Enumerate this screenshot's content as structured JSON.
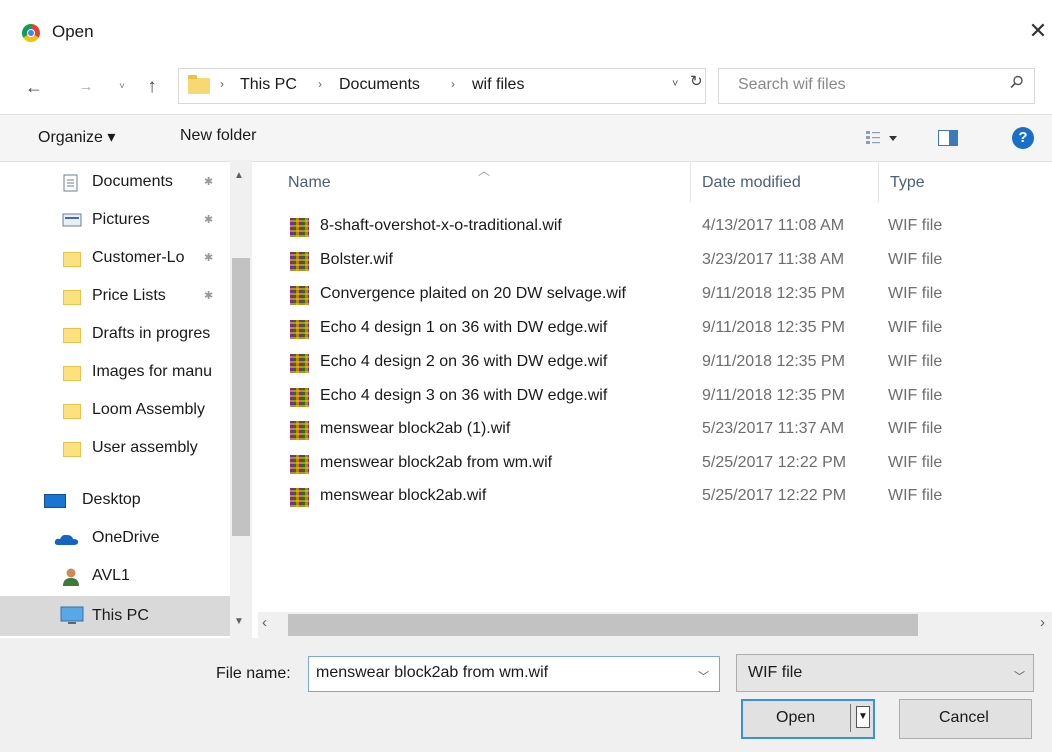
{
  "window": {
    "title": "Open",
    "close_glyph": "✕"
  },
  "nav": {
    "back_glyph": "←",
    "forward_glyph": "→",
    "recent_glyph": "˅",
    "up_glyph": "↑",
    "breadcrumb": [
      "This PC",
      "Documents",
      "wif files"
    ],
    "breadcrumb_sep": "›",
    "dropdown_glyph": "˅",
    "refresh_glyph": "↻",
    "search_placeholder": "Search wif files"
  },
  "toolbar": {
    "organize_label": "Organize ▾",
    "new_folder_label": "New folder",
    "help_glyph": "?"
  },
  "sidebar": {
    "items": [
      {
        "label": "Documents",
        "icon": "document-icon",
        "pinned": true
      },
      {
        "label": "Pictures",
        "icon": "pictures-icon",
        "pinned": true
      },
      {
        "label": "Customer-Lo",
        "icon": "folder-icon",
        "pinned": true
      },
      {
        "label": "Price Lists",
        "icon": "folder-icon",
        "pinned": true
      },
      {
        "label": "Drafts in progres",
        "icon": "folder-icon",
        "pinned": false
      },
      {
        "label": "Images for manu",
        "icon": "folder-icon",
        "pinned": false
      },
      {
        "label": "Loom Assembly",
        "icon": "folder-icon",
        "pinned": false
      },
      {
        "label": "User assembly",
        "icon": "folder-icon",
        "pinned": false
      },
      {
        "label": "Desktop",
        "icon": "desktop-icon",
        "pinned": false
      },
      {
        "label": "OneDrive",
        "icon": "onedrive-icon",
        "pinned": false
      },
      {
        "label": "AVL1",
        "icon": "user-icon",
        "pinned": false
      },
      {
        "label": "This PC",
        "icon": "pc-icon",
        "pinned": false,
        "selected": true
      }
    ],
    "pin_glyph": "📌"
  },
  "filelist": {
    "columns": {
      "name": "Name",
      "date": "Date modified",
      "type": "Type"
    },
    "files": [
      {
        "name": "8-shaft-overshot-x-o-traditional.wif",
        "date": "4/13/2017 11:08 AM",
        "type": "WIF file"
      },
      {
        "name": "Bolster.wif",
        "date": "3/23/2017 11:38 AM",
        "type": "WIF file"
      },
      {
        "name": "Convergence plaited on 20 DW selvage.wif",
        "date": "9/11/2018 12:35 PM",
        "type": "WIF file"
      },
      {
        "name": "Echo 4 design 1 on 36 with DW edge.wif",
        "date": "9/11/2018 12:35 PM",
        "type": "WIF file"
      },
      {
        "name": "Echo 4 design 2 on 36 with DW edge.wif",
        "date": "9/11/2018 12:35 PM",
        "type": "WIF file"
      },
      {
        "name": "Echo 4 design 3 on 36 with DW edge.wif",
        "date": "9/11/2018 12:35 PM",
        "type": "WIF file"
      },
      {
        "name": "menswear block2ab (1).wif",
        "date": "5/23/2017 11:37 AM",
        "type": "WIF file"
      },
      {
        "name": "menswear block2ab from wm.wif",
        "date": "5/25/2017 12:22 PM",
        "type": "WIF file"
      },
      {
        "name": "menswear block2ab.wif",
        "date": "5/25/2017 12:22 PM",
        "type": "WIF file"
      }
    ]
  },
  "footer": {
    "filename_label": "File name:",
    "filename_value": "menswear block2ab from wm.wif",
    "filetype_value": "WIF file",
    "open_label": "Open",
    "cancel_label": "Cancel"
  }
}
